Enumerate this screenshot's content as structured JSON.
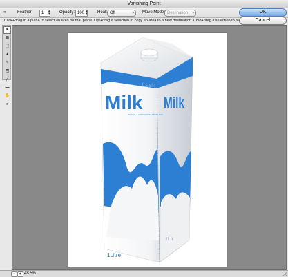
{
  "window": {
    "title": "Vanishing Point"
  },
  "options_bar": {
    "feather_label": "Feather:",
    "feather_value": "1",
    "opacity_label": "Opacity:",
    "opacity_value": "100",
    "heal_label": "Heal:",
    "heal_value": "Off",
    "move_mode_label": "Move Mode:",
    "move_mode_value": "Destination"
  },
  "hint": "Click+drag in a plane to select an area on that plane. Opt+drag a selection to copy an area to a new destination. Cmd+drag a selection to fill th",
  "buttons": {
    "ok": "OK",
    "cancel": "Cancel"
  },
  "tools": [
    "edit-plane",
    "create-plane",
    "marquee",
    "stamp",
    "brush",
    "transform",
    "eyedropper",
    "measure",
    "hand",
    "zoom"
  ],
  "image": {
    "carton_brand": "Milk",
    "carton_sub": "fresh",
    "carton_small": "NATURAL & HOMOGENIZED FRESH MILK",
    "carton_volume": "1Litre",
    "side_brand": "Milk",
    "side_volume": "1Lit",
    "colors": {
      "blue": "#2c7fd3",
      "white": "#ffffff"
    }
  },
  "status": {
    "zoom": "48.5%"
  }
}
